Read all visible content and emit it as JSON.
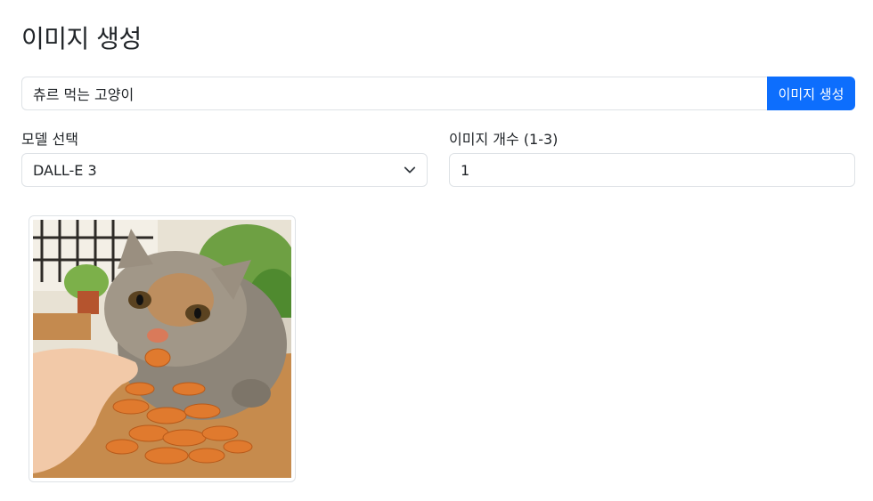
{
  "page": {
    "title": "이미지 생성"
  },
  "prompt": {
    "value": "츄르 먹는 고양이",
    "button_label": "이미지 생성"
  },
  "model": {
    "label": "모델 선택",
    "selected": "DALL-E 3"
  },
  "count": {
    "label": "이미지 개수 (1-3)",
    "value": "1"
  },
  "results": {
    "images": [
      {
        "alt": "generated-cat-image"
      }
    ]
  },
  "colors": {
    "primary": "#0d6efd",
    "border": "#dee2e6",
    "text": "#212529"
  }
}
